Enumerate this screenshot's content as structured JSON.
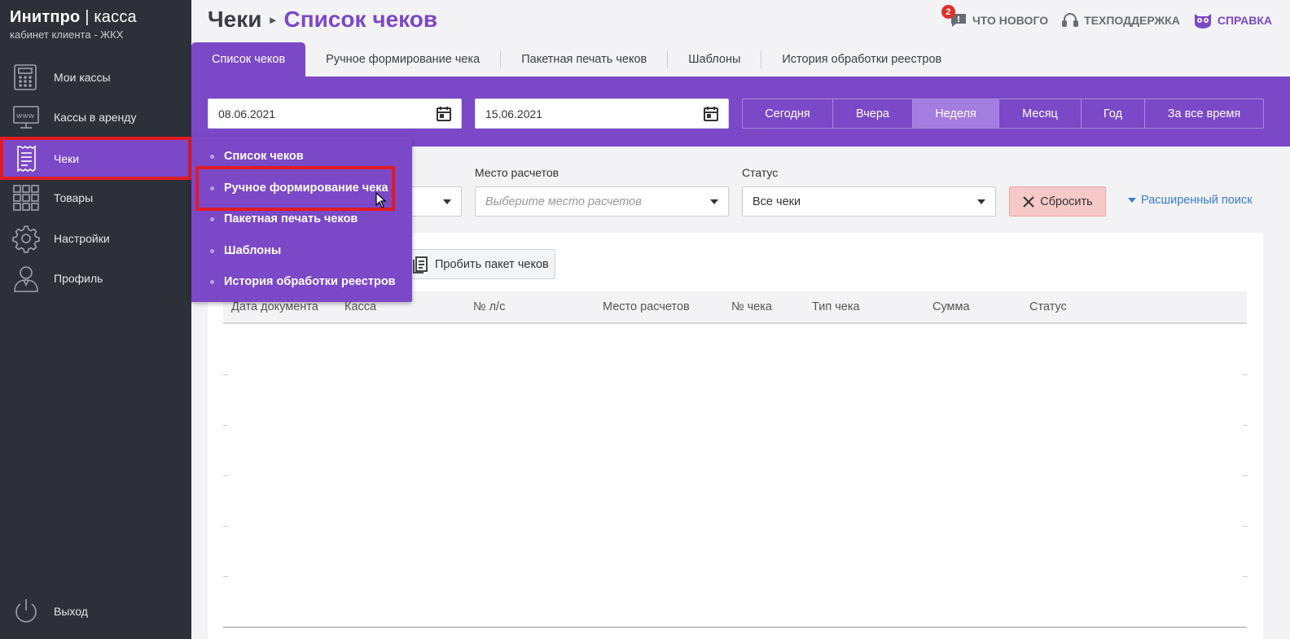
{
  "brand": {
    "name": "Инитпро",
    "separator": "|",
    "product": "касса",
    "subtitle": "кабинет клиента - ЖКХ"
  },
  "sidebar": {
    "items": [
      {
        "label": "Мои кассы",
        "icon": "cash-register-icon"
      },
      {
        "label": "Кассы в аренду",
        "icon": "www-monitor-icon"
      },
      {
        "label": "Чеки",
        "icon": "receipt-icon",
        "active": true
      },
      {
        "label": "Товары",
        "icon": "grid-icon"
      },
      {
        "label": "Настройки",
        "icon": "gear-icon"
      },
      {
        "label": "Профиль",
        "icon": "user-icon"
      }
    ],
    "logout": {
      "label": "Выход",
      "icon": "power-icon"
    }
  },
  "header": {
    "breadcrumb_parent": "Чеки",
    "breadcrumb_current": "Список чеков",
    "whats_new": {
      "label": "ЧТО НОВОГО",
      "badge": "2"
    },
    "support": {
      "label": "ТЕХПОДДЕРЖКА"
    },
    "help": {
      "label": "СПРАВКА"
    }
  },
  "tabs": [
    {
      "label": "Список чеков",
      "active": true
    },
    {
      "label": "Ручное формирование чека"
    },
    {
      "label": "Пакетная печать чеков"
    },
    {
      "label": "Шаблоны"
    },
    {
      "label": "История обработки реестров"
    }
  ],
  "filters": {
    "date_from": "08.06.2021",
    "date_to": "15.06.2021",
    "periods": [
      {
        "label": "Сегодня"
      },
      {
        "label": "Вчера"
      },
      {
        "label": "Неделя",
        "selected": true
      },
      {
        "label": "Месяц"
      },
      {
        "label": "Год"
      },
      {
        "label": "За все время"
      }
    ],
    "place_label": "Место расчетов",
    "place_placeholder": "Выберите место расчетов",
    "status_label": "Статус",
    "status_value": "Все чеки",
    "reset_label": "Сбросить",
    "advanced_search_label": "Расширенный поиск"
  },
  "actions": {
    "batch_button": "Пробить пакет чеков"
  },
  "table": {
    "columns": [
      "Дата документа",
      "Касса",
      "№ л/с",
      "Место расчетов",
      "№ чека",
      "Тип чека",
      "Сумма",
      "Статус"
    ]
  },
  "dropdown": {
    "items": [
      {
        "label": "Список чеков"
      },
      {
        "label": "Ручное формирование чека",
        "highlighted": true
      },
      {
        "label": "Пакетная печать чеков"
      },
      {
        "label": "Шаблоны"
      },
      {
        "label": "История обработки реестров"
      }
    ]
  },
  "colors": {
    "accent": "#7b48c8",
    "sidebar": "#2e3039",
    "highlight": "#e01b24",
    "link": "#3a7bd5"
  }
}
